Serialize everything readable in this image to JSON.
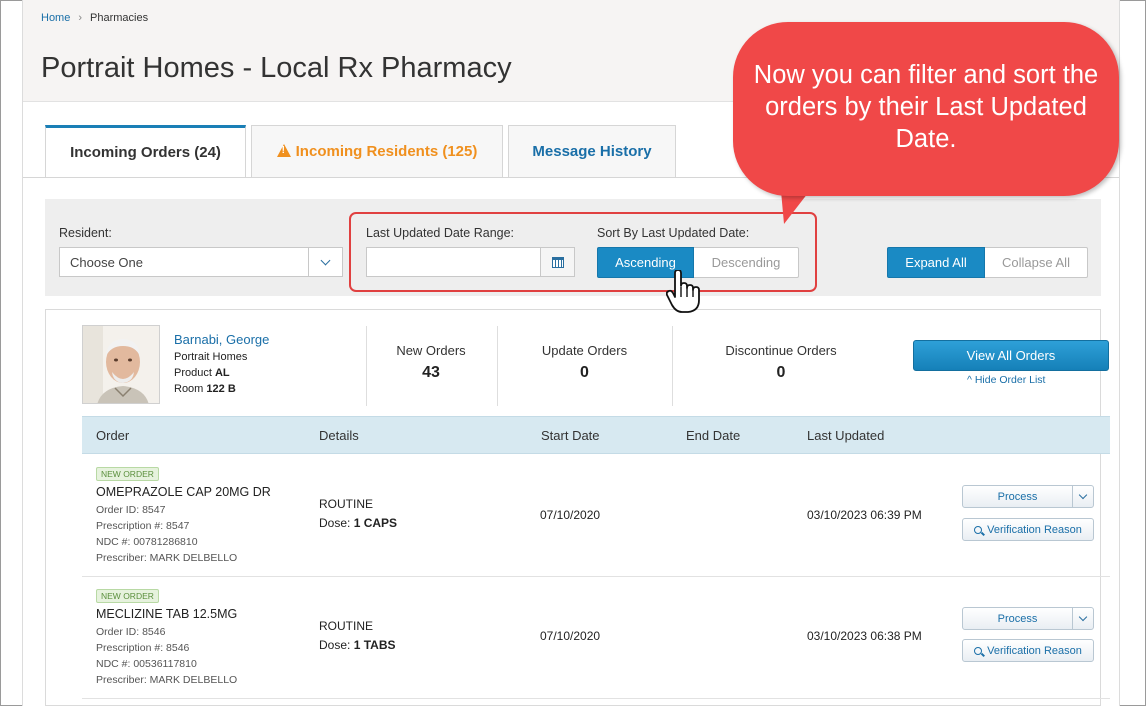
{
  "breadcrumb": {
    "home": "Home",
    "current": "Pharmacies"
  },
  "page": {
    "title": "Portrait Homes - Local Rx Pharmacy"
  },
  "tabs": [
    {
      "label": "Incoming Orders (24)",
      "active": true
    },
    {
      "label": "Incoming Residents (125)",
      "icon": "warning-icon"
    },
    {
      "label": "Message History"
    }
  ],
  "filters": {
    "resident_label": "Resident:",
    "resident_value": "Choose One",
    "date_range_label": "Last Updated Date Range:",
    "date_range_value": "",
    "sort_label": "Sort By Last Updated Date:",
    "sort_ascending": "Ascending",
    "sort_descending": "Descending",
    "sort_selected": "Ascending",
    "expand_all": "Expand All",
    "collapse_all": "Collapse All"
  },
  "callout": {
    "text": "Now you can filter and sort the orders by their Last Updated Date."
  },
  "resident": {
    "name": "Barnabi, George",
    "facility": "Portrait Homes",
    "product_label": "Product",
    "product": "AL",
    "room_label": "Room",
    "room": "122 B",
    "stats": [
      {
        "label": "New Orders",
        "value": "43"
      },
      {
        "label": "Update Orders",
        "value": "0"
      },
      {
        "label": "Discontinue Orders",
        "value": "0"
      }
    ],
    "view_all": "View All Orders",
    "hide_list": "^ Hide Order List"
  },
  "table": {
    "headers": [
      "Order",
      "Details",
      "Start Date",
      "End Date",
      "Last Updated"
    ],
    "rows": [
      {
        "badge": "NEW ORDER",
        "drug": "OMEPRAZOLE CAP 20MG DR",
        "order_id": "Order ID: 8547",
        "prescription": "Prescription #: 8547",
        "ndc": "NDC #: 00781286810",
        "prescriber": "Prescriber: MARK DELBELLO",
        "detail_type": "ROUTINE",
        "dose_label": "Dose:",
        "dose": "1 CAPS",
        "start_date": "07/10/2020",
        "end_date": "",
        "last_updated": "03/10/2023 06:39 PM",
        "process": "Process",
        "verification": "Verification Reason"
      },
      {
        "badge": "NEW ORDER",
        "drug": "MECLIZINE TAB 12.5MG",
        "order_id": "Order ID: 8546",
        "prescription": "Prescription #: 8546",
        "ndc": "NDC #: 00536117810",
        "prescriber": "Prescriber: MARK DELBELLO",
        "detail_type": "ROUTINE",
        "dose_label": "Dose:",
        "dose": "1 TABS",
        "start_date": "07/10/2020",
        "end_date": "",
        "last_updated": "03/10/2023 06:38 PM",
        "process": "Process",
        "verification": "Verification Reason"
      }
    ]
  },
  "colors": {
    "accent": "#1a8ac4",
    "callout": "#f04848",
    "warning": "#f0901e",
    "link": "#1a6fa8"
  }
}
